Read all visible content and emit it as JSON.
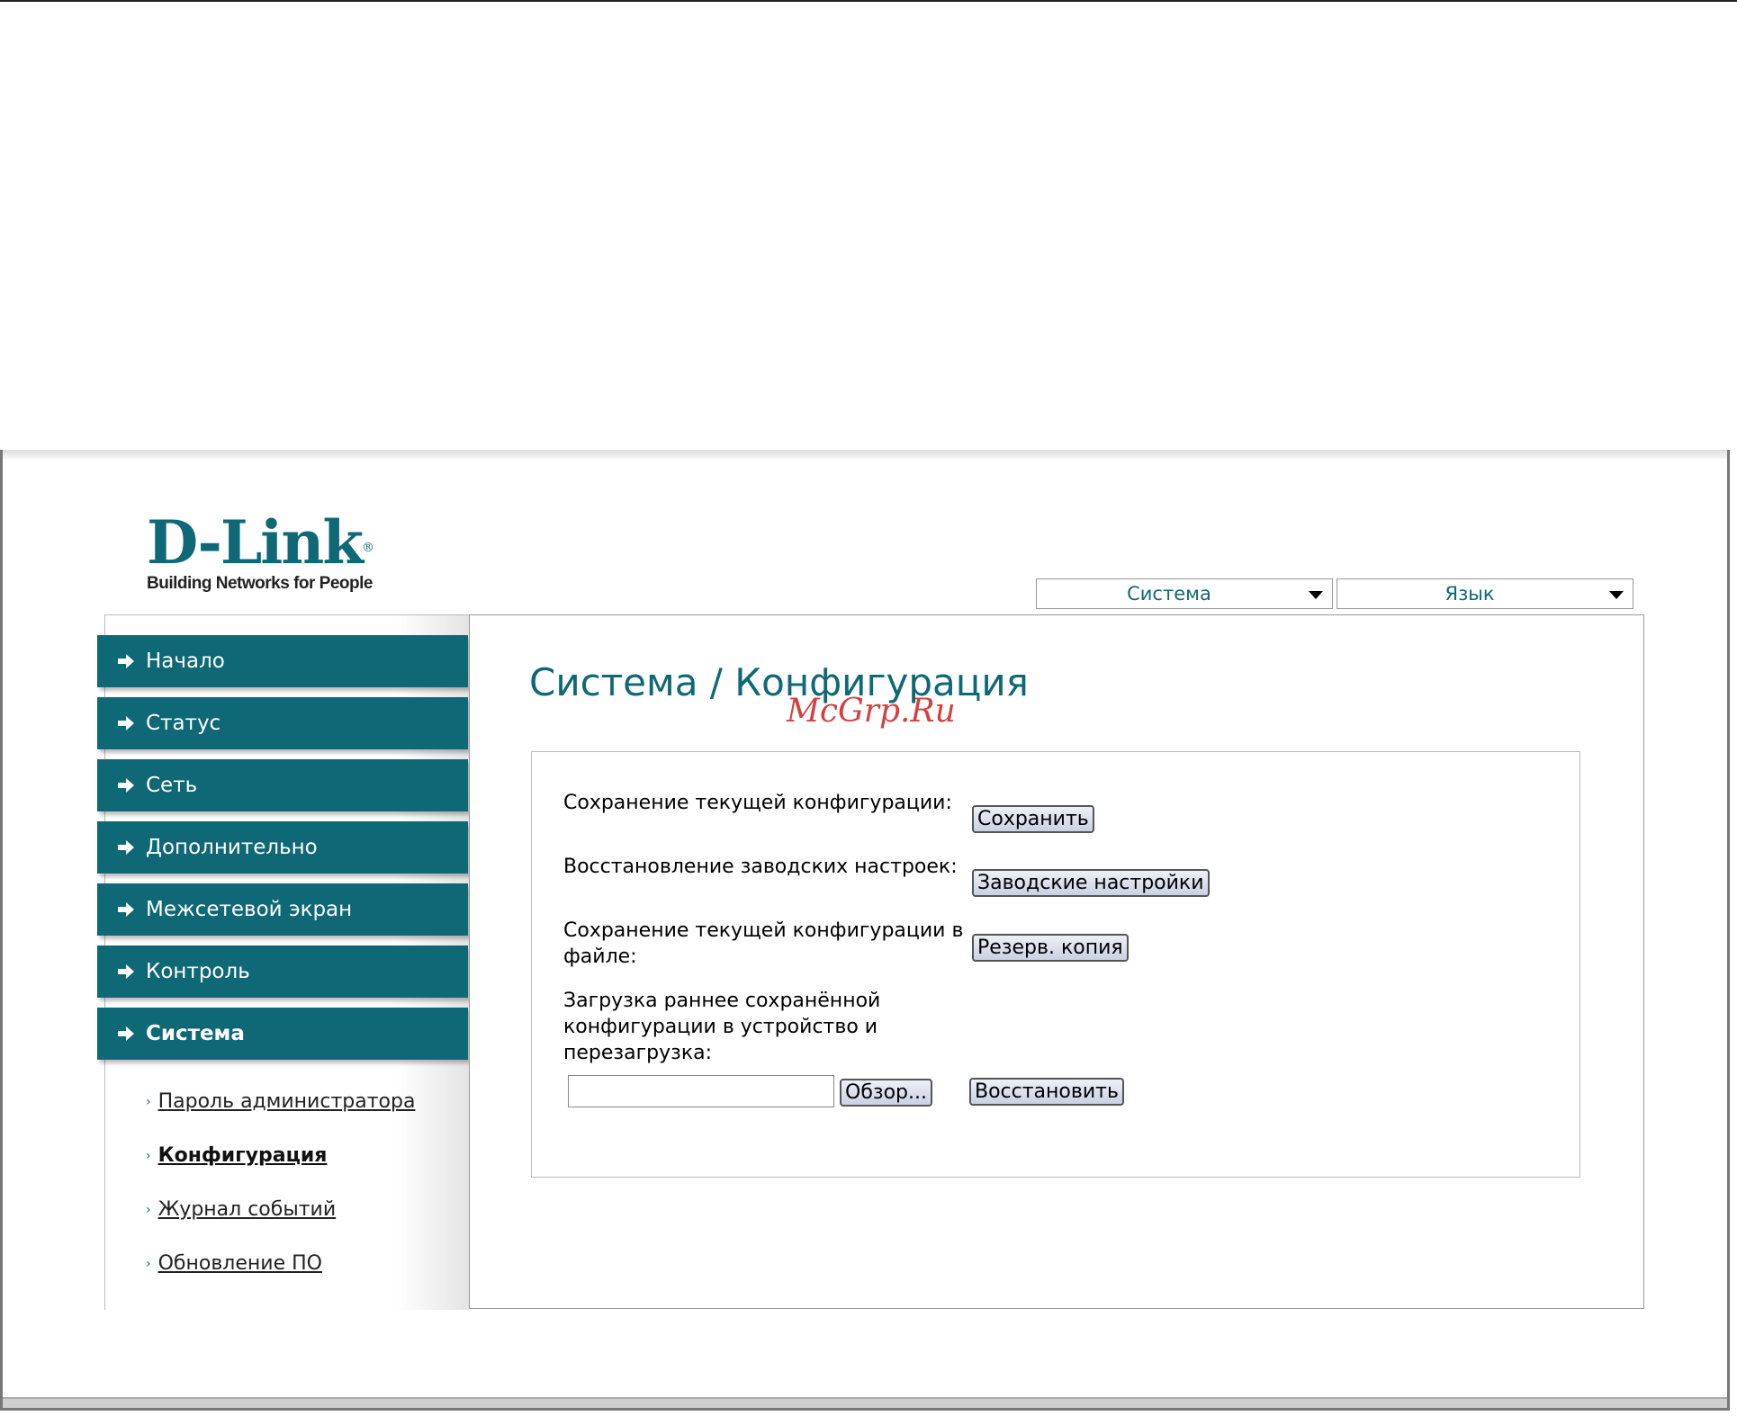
{
  "logo": {
    "brand": "D-Link",
    "registered": "®",
    "tagline": "Building Networks for People"
  },
  "menus": {
    "system_label": "Система",
    "language_label": "Язык"
  },
  "sidebar": {
    "items": [
      {
        "label": "Начало"
      },
      {
        "label": "Статус"
      },
      {
        "label": "Сеть"
      },
      {
        "label": "Дополнительно"
      },
      {
        "label": "Межсетевой экран"
      },
      {
        "label": "Контроль"
      },
      {
        "label": "Система"
      }
    ],
    "subitems": [
      {
        "label": "Пароль администратора"
      },
      {
        "label": "Конфигурация"
      },
      {
        "label": "Журнал событий"
      },
      {
        "label": "Обновление ПО"
      }
    ]
  },
  "page": {
    "title": "Система / Конфигурация",
    "watermark": "McGrp.Ru"
  },
  "config": {
    "save_label": "Сохранение текущей конфигурации:",
    "save_button": "Сохранить",
    "factory_label": "Восстановление заводских настроек:",
    "factory_button": "Заводские настройки",
    "backup_label_1": "Сохранение текущей конфигурации в",
    "backup_label_2": "файле:",
    "backup_button": "Резерв. копия",
    "restore_label_1": "Загрузка раннее сохранённой",
    "restore_label_2": "конфигурации в устройство и",
    "restore_label_3": "перезагрузка:",
    "file_value": "",
    "browse_button": "Обзор...",
    "restore_button": "Восстановить"
  }
}
